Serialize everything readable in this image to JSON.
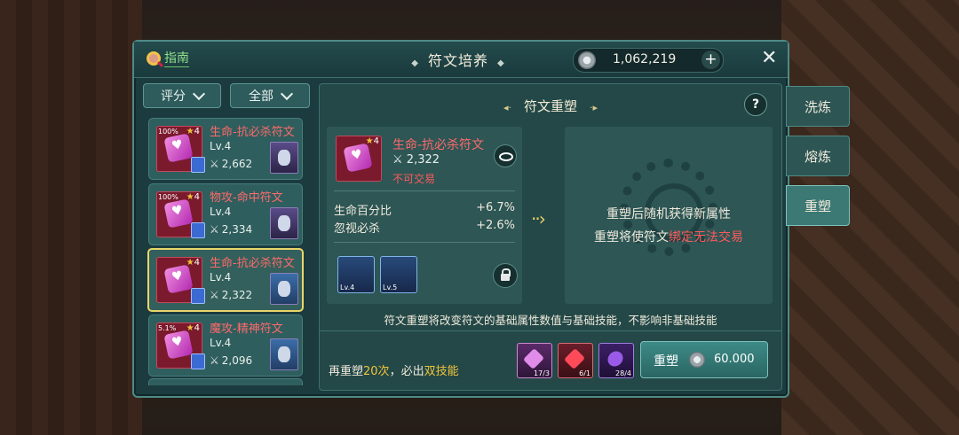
{
  "header": {
    "guide_label": "指南",
    "title": "符文培养",
    "currency_value": "1,062,219",
    "plus_label": "+",
    "close_label": "✕"
  },
  "filters": {
    "sort_label": "评分",
    "type_label": "全部"
  },
  "rune_list": [
    {
      "name": "生命-抗必杀符文",
      "level": "Lv.4",
      "score": "2,662",
      "percent": "100%",
      "star": "4",
      "pet": "purple"
    },
    {
      "name": "物攻-命中符文",
      "level": "Lv.4",
      "score": "2,334",
      "percent": "100%",
      "star": "4",
      "pet": "purple"
    },
    {
      "name": "生命-抗必杀符文",
      "level": "Lv.4",
      "score": "2,322",
      "percent": "",
      "star": "4",
      "pet": "blue",
      "selected": true
    },
    {
      "name": "魔攻-精神符文",
      "level": "Lv.4",
      "score": "2,096",
      "percent": "5.1%",
      "star": "4",
      "pet": "blue"
    }
  ],
  "main": {
    "section_title": "符文重塑",
    "help_label": "?",
    "detail": {
      "name": "生命-抗必杀符文",
      "star": "4",
      "score": "2,322",
      "trade_status": "不可交易",
      "attrs": [
        {
          "name": "生命百分比",
          "value": "+6.7%"
        },
        {
          "name": "忽视必杀",
          "value": "+2.6%"
        }
      ],
      "skills": [
        {
          "level": "Lv.4"
        },
        {
          "level": "Lv.5"
        }
      ]
    },
    "result": {
      "line1": "重塑后随机获得新属性",
      "line2_prefix": "重塑将使符文",
      "line2_red": "绑定无法交易"
    },
    "note": "符文重塑将改变符文的基础属性数值与基础技能，不影响非基础技能",
    "count_prefix": "再重塑",
    "count_value": "20次",
    "count_mid": "，必出",
    "count_suffix": "双技能",
    "materials": [
      {
        "qty": "17/3",
        "color": "#b44cc0"
      },
      {
        "qty": "6/1",
        "color": "#d33a4a"
      },
      {
        "qty": "28/4",
        "color": "#8a3cd6"
      }
    ],
    "recast_label": "重塑",
    "recast_cost": "60.000"
  },
  "side_tabs": [
    "洗炼",
    "熔炼",
    "重塑"
  ],
  "colors": {
    "accent": "#e9d56b",
    "rune_name": "#ff6a6a",
    "panel": "#1c3b3e"
  }
}
